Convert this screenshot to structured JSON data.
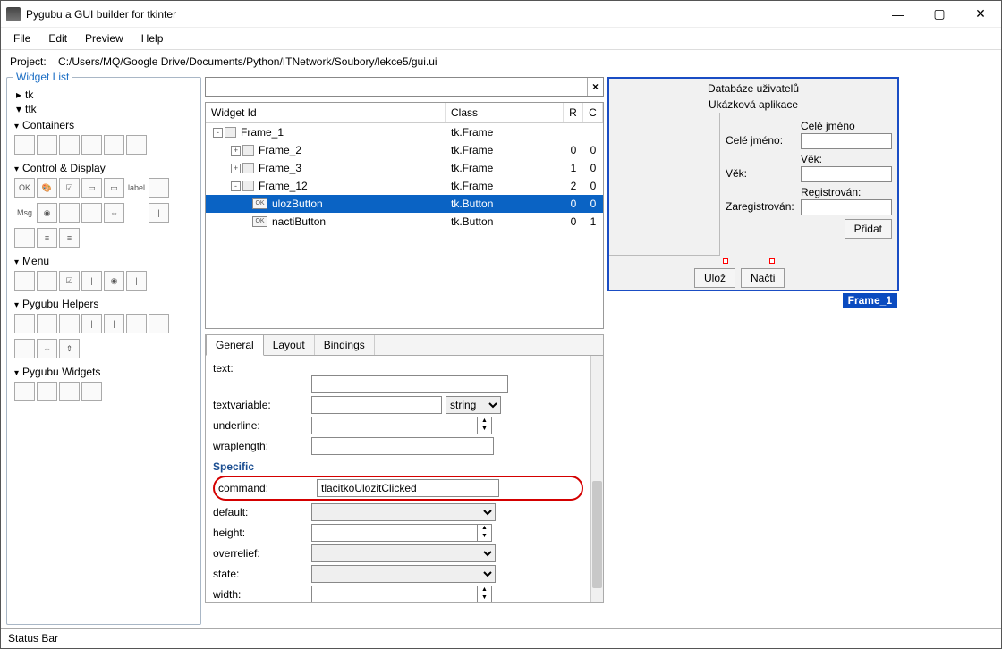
{
  "window": {
    "title": "Pygubu a GUI builder for tkinter"
  },
  "menu": {
    "file": "File",
    "edit": "Edit",
    "preview": "Preview",
    "help": "Help"
  },
  "project": {
    "label": "Project:",
    "path": "C:/Users/MQ/Google Drive/Documents/Python/ITNetwork/Soubory/lekce5/gui.ui"
  },
  "widget_list": {
    "title": "Widget List",
    "tk": "tk",
    "ttk": "ttk",
    "sections": {
      "containers": "Containers",
      "control": "Control & Display",
      "menu": "Menu",
      "helpers": "Pygubu Helpers",
      "pw": "Pygubu Widgets"
    },
    "palette_labels": {
      "ok": "OK",
      "label": "label",
      "msg": "Msg"
    }
  },
  "tree": {
    "cols": {
      "id": "Widget Id",
      "class": "Class",
      "r": "R",
      "c": "C"
    },
    "rows": [
      {
        "id": "Frame_1",
        "class": "tk.Frame",
        "r": "",
        "c": "",
        "ind": 8,
        "exp": "-"
      },
      {
        "id": "Frame_2",
        "class": "tk.Frame",
        "r": "0",
        "c": "0",
        "ind": 28,
        "exp": "+"
      },
      {
        "id": "Frame_3",
        "class": "tk.Frame",
        "r": "1",
        "c": "0",
        "ind": 28,
        "exp": "+"
      },
      {
        "id": "Frame_12",
        "class": "tk.Frame",
        "r": "2",
        "c": "0",
        "ind": 28,
        "exp": "-"
      },
      {
        "id": "ulozButton",
        "class": "tk.Button",
        "r": "0",
        "c": "0",
        "ind": 52,
        "btn": true,
        "sel": true
      },
      {
        "id": "nactiButton",
        "class": "tk.Button",
        "r": "0",
        "c": "1",
        "ind": 52,
        "btn": true
      }
    ]
  },
  "tabs": {
    "general": "General",
    "layout": "Layout",
    "bindings": "Bindings"
  },
  "props": {
    "text": "text:",
    "textvariable": "textvariable:",
    "tv_type": "string",
    "underline": "underline:",
    "wraplength": "wraplength:",
    "specific_h": "Specific",
    "command": "command:",
    "command_val": "tlacitkoUlozitClicked",
    "default": "default:",
    "height": "height:",
    "overrelief": "overrelief:",
    "state": "state:",
    "width": "width:"
  },
  "preview": {
    "title": "Databáze uživatelů",
    "subtitle": "Ukázková aplikace",
    "fields": {
      "name_l": "Celé jméno:",
      "name_h": "Celé jméno",
      "age_l": "Věk:",
      "age_h": "Věk:",
      "reg_l": "Zaregistrován:",
      "reg_h": "Registrován:"
    },
    "add_btn": "Přidat",
    "save_btn": "Ulož",
    "load_btn": "Načti",
    "frame_label": "Frame_1"
  },
  "status": "Status Bar"
}
